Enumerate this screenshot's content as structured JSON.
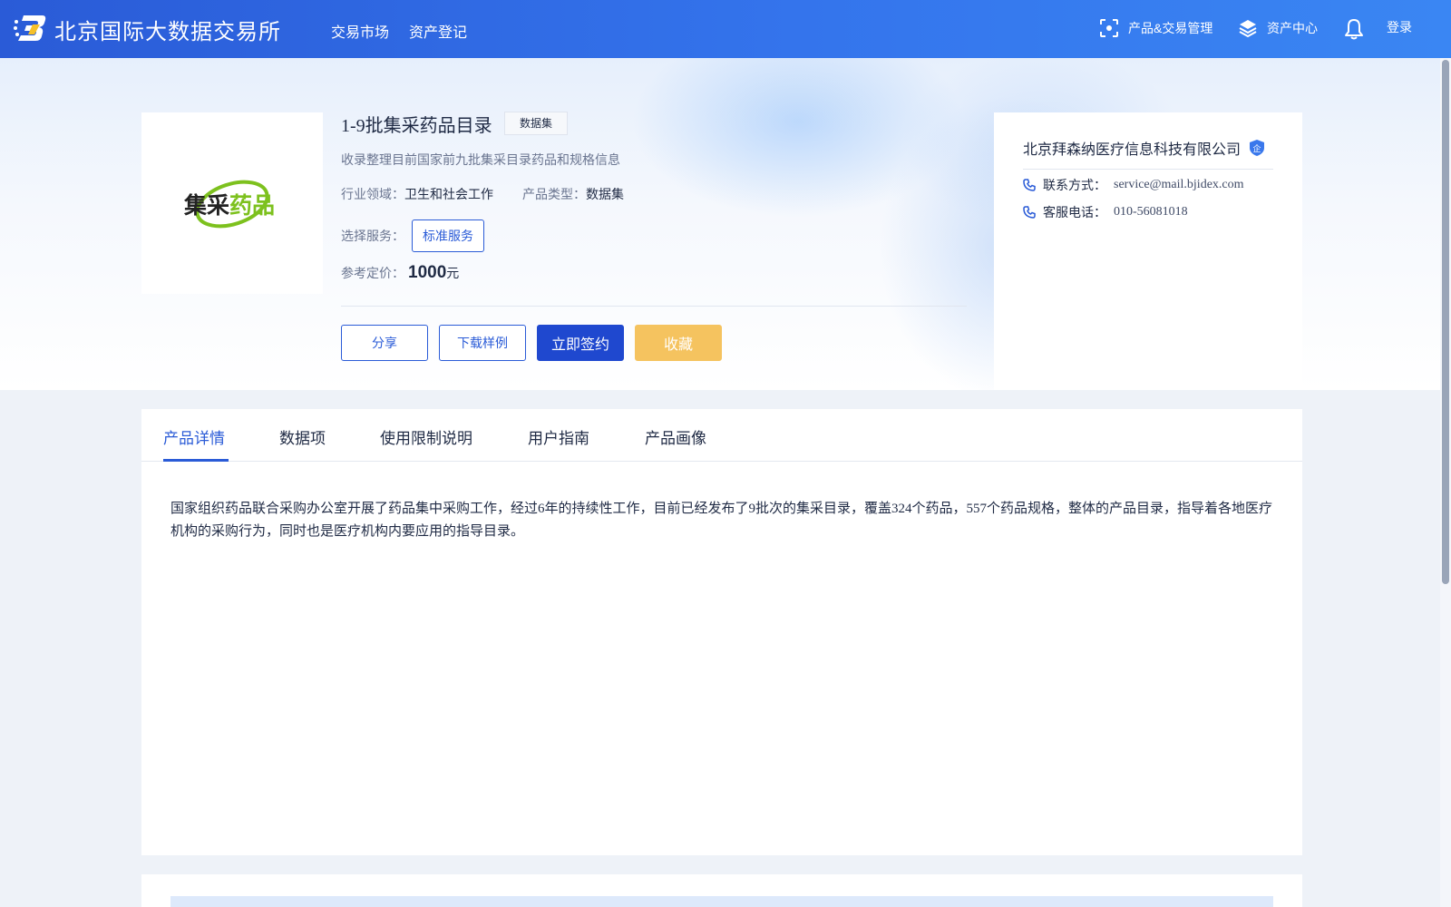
{
  "header": {
    "site_name": "北京国际大数据交易所",
    "nav": [
      "交易市场",
      "资产登记"
    ],
    "product_mgmt_label": "产品&交易管理",
    "asset_center_label": "资产中心",
    "login_label": "登录"
  },
  "product": {
    "title": "1-9批集采药品目录",
    "type_tag": "数据集",
    "description": "收录整理目前国家前九批集采目录药品和规格信息",
    "image_text": "集采药品",
    "industry_label": "行业领域：",
    "industry_value": "卫生和社会工作",
    "product_type_label": "产品类型：",
    "product_type_value": "数据集",
    "service_label": "选择服务：",
    "service_option": "标准服务",
    "price_label": "参考定价：",
    "price_value": "1000",
    "price_unit": "元"
  },
  "actions": {
    "share": "分享",
    "download_sample": "下载样例",
    "sign_now": "立即签约",
    "favorite": "收藏"
  },
  "seller": {
    "name": "北京拜森纳医疗信息科技有限公司",
    "badge_text": "企",
    "contact_label": "联系方式：",
    "contact_value": "service@mail.bjidex.com",
    "phone_label": "客服电话：",
    "phone_value": "010-56081018"
  },
  "tabs": {
    "items": [
      "产品详情",
      "数据项",
      "使用限制说明",
      "用户指南",
      "产品画像"
    ],
    "active_index": 0
  },
  "detail": {
    "text": "国家组织药品联合采购办公室开展了药品集中采购工作，经过6年的持续性工作，目前已经发布了9批次的集采目录，覆盖324个药品，557个药品规格，整体的产品目录，指导着各地医疗机构的采购行为，同时也是医疗机构内要应用的指导目录。"
  },
  "colors": {
    "brand_blue": "#2a5bd7",
    "primary_button": "#1f48cf",
    "favorite_button": "#f5c35f",
    "logo_dark": "#222222",
    "logo_green": "#7dc11e"
  },
  "icons": {
    "logo": "bjidex-logo-icon",
    "product_mgmt": "scan-frame-icon",
    "asset_center": "layers-icon",
    "notifications": "bell-icon",
    "verified": "shield-badge-icon",
    "contact": "phone-icon",
    "phone": "phone-icon"
  }
}
